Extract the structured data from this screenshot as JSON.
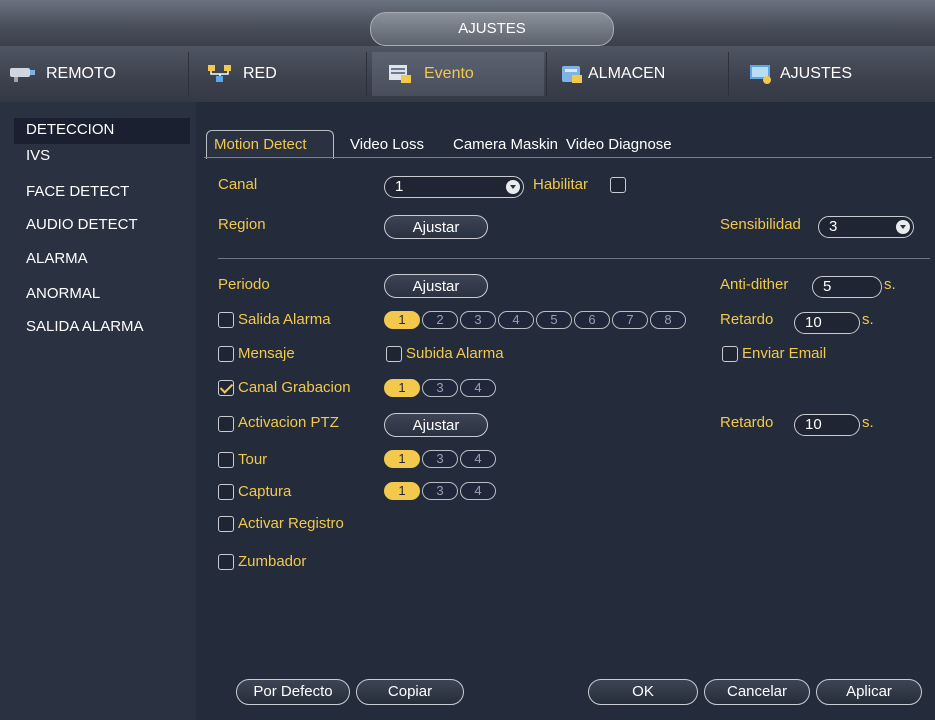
{
  "window": {
    "title": "AJUSTES"
  },
  "topnav": [
    {
      "label": "REMOTO",
      "icon": "camera-icon"
    },
    {
      "label": "RED",
      "icon": "network-icon"
    },
    {
      "label": "Evento",
      "icon": "event-icon"
    },
    {
      "label": "ALMACEN",
      "icon": "storage-icon"
    },
    {
      "label": "AJUSTES",
      "icon": "settings-icon"
    }
  ],
  "sidebar": {
    "items": [
      {
        "label": "DETECCION"
      },
      {
        "label": "IVS"
      },
      {
        "label": "FACE DETECT"
      },
      {
        "label": "AUDIO DETECT"
      },
      {
        "label": "ALARMA"
      },
      {
        "label": "ANORMAL"
      },
      {
        "label": "SALIDA ALARMA"
      }
    ]
  },
  "subtabs": [
    {
      "label": "Motion Detect"
    },
    {
      "label": "Video Loss"
    },
    {
      "label": "Camera Maskin"
    },
    {
      "label": "Video Diagnose"
    }
  ],
  "form": {
    "canal_label": "Canal",
    "canal_value": "1",
    "habilitar_label": "Habilitar",
    "region_label": "Region",
    "ajustar_label": "Ajustar",
    "sensibilidad_label": "Sensibilidad",
    "sensibilidad_value": "3",
    "periodo_label": "Periodo",
    "antidither_label": "Anti-dither",
    "antidither_value": "5",
    "seconds_unit": "s.",
    "salida_alarma_label": "Salida Alarma",
    "alarm_outputs": [
      "1",
      "2",
      "3",
      "4",
      "5",
      "6",
      "7",
      "8"
    ],
    "retardo_label": "Retardo",
    "retardo_value": "10",
    "mensaje_label": "Mensaje",
    "subida_alarma_label": "Subida Alarma",
    "enviar_email_label": "Enviar Email",
    "canal_grabacion_label": "Canal Grabacion",
    "channels": [
      "1",
      "3",
      "4"
    ],
    "activacion_ptz_label": "Activacion PTZ",
    "retardo2_label": "Retardo",
    "retardo2_value": "10",
    "tour_label": "Tour",
    "captura_label": "Captura",
    "activar_registro_label": "Activar Registro",
    "zumbador_label": "Zumbador"
  },
  "buttons": {
    "default": "Por Defecto",
    "copy": "Copiar",
    "ok": "OK",
    "cancel": "Cancelar",
    "apply": "Aplicar"
  },
  "colors": {
    "accent": "#f2c94c",
    "background": "#262d3c"
  }
}
